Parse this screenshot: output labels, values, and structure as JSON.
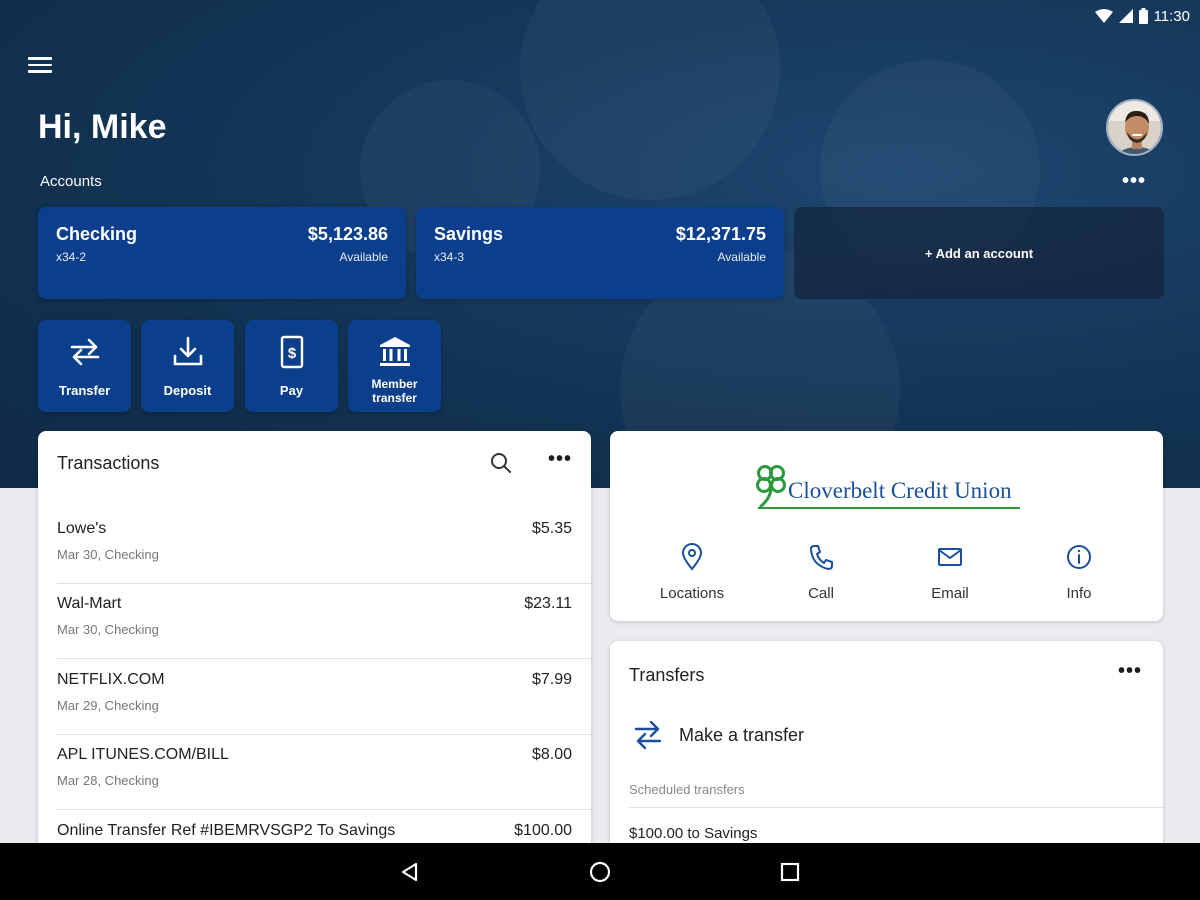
{
  "status_bar": {
    "time": "11:30"
  },
  "header": {
    "greeting": "Hi, Mike",
    "accounts_label": "Accounts",
    "more": "•••"
  },
  "accounts": [
    {
      "name": "Checking",
      "number": "x34-2",
      "balance": "$5,123.86",
      "available_label": "Available"
    },
    {
      "name": "Savings",
      "number": "x34-3",
      "balance": "$12,371.75",
      "available_label": "Available"
    }
  ],
  "add_account_label": "+ Add an account",
  "quick_actions": [
    {
      "label": "Transfer",
      "icon": "transfer-icon"
    },
    {
      "label": "Deposit",
      "icon": "deposit-icon"
    },
    {
      "label": "Pay",
      "icon": "pay-bill-icon"
    },
    {
      "label": "Member transfer",
      "icon": "bank-icon"
    }
  ],
  "transactions": {
    "title": "Transactions",
    "more": "•••",
    "items": [
      {
        "description": "Lowe's",
        "amount": "$5.35",
        "meta": "Mar 30, Checking"
      },
      {
        "description": "Wal-Mart",
        "amount": "$23.11",
        "meta": "Mar 30, Checking"
      },
      {
        "description": "NETFLIX.COM",
        "amount": "$7.99",
        "meta": "Mar 29, Checking"
      },
      {
        "description": "APL ITUNES.COM/BILL",
        "amount": "$8.00",
        "meta": "Mar 28, Checking"
      },
      {
        "description": "Online Transfer Ref #IBEMRVSGP2 To Savings",
        "amount": "$100.00",
        "meta": ""
      }
    ]
  },
  "credit_union": {
    "name": "Cloverbelt Credit Union",
    "actions": [
      {
        "label": "Locations",
        "icon": "location-pin-icon"
      },
      {
        "label": "Call",
        "icon": "phone-icon"
      },
      {
        "label": "Email",
        "icon": "email-icon"
      },
      {
        "label": "Info",
        "icon": "info-icon"
      }
    ]
  },
  "transfers": {
    "title": "Transfers",
    "more": "•••",
    "make_transfer": "Make a transfer",
    "scheduled_label": "Scheduled transfers",
    "scheduled": [
      {
        "label": "$100.00 to Savings"
      }
    ]
  },
  "colors": {
    "primary_blue": "#0b3f8c",
    "hero_bg": "#173a5e",
    "clover_green": "#2a9a3a"
  }
}
